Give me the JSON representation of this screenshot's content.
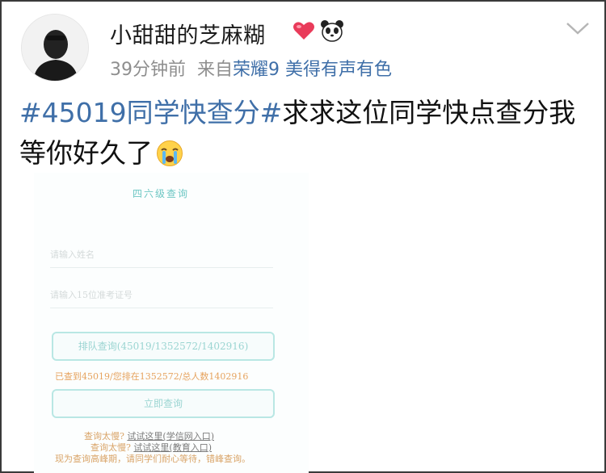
{
  "post": {
    "username": "小甜甜的芝麻糊",
    "badge_icons": [
      "heart-icon",
      "panda-icon"
    ],
    "time": "39分钟前",
    "source_prefix": "来自",
    "device": "荣耀9 美得有声有色",
    "hashtag": "#45019同学快查分#",
    "body": "求求这位同学快点查分我等你好久了",
    "emoji": "crying-face-icon"
  },
  "screenshot": {
    "title": "四六级查询",
    "name_placeholder": "请输入姓名",
    "id_placeholder": "请输入15位准考证号",
    "queue_button": "排队查询(45019/1352572/1402916)",
    "status": "已查到45019/您排在1352572/总人数1402916",
    "query_button": "立即查询",
    "hint1_text": "查询太慢?",
    "hint1_link": "试试这里(学信网入口)",
    "hint2_text": "查询太慢?",
    "hint2_link": "试试这里(教育入口)",
    "hint3_text": "现为查询高峰期，请同学们耐心等待，错峰查询。"
  },
  "colors": {
    "link_blue": "#3f6fa8",
    "meta_gray": "#8e8e8e",
    "teal": "#6ec7c4",
    "orange": "#e6a35e"
  }
}
